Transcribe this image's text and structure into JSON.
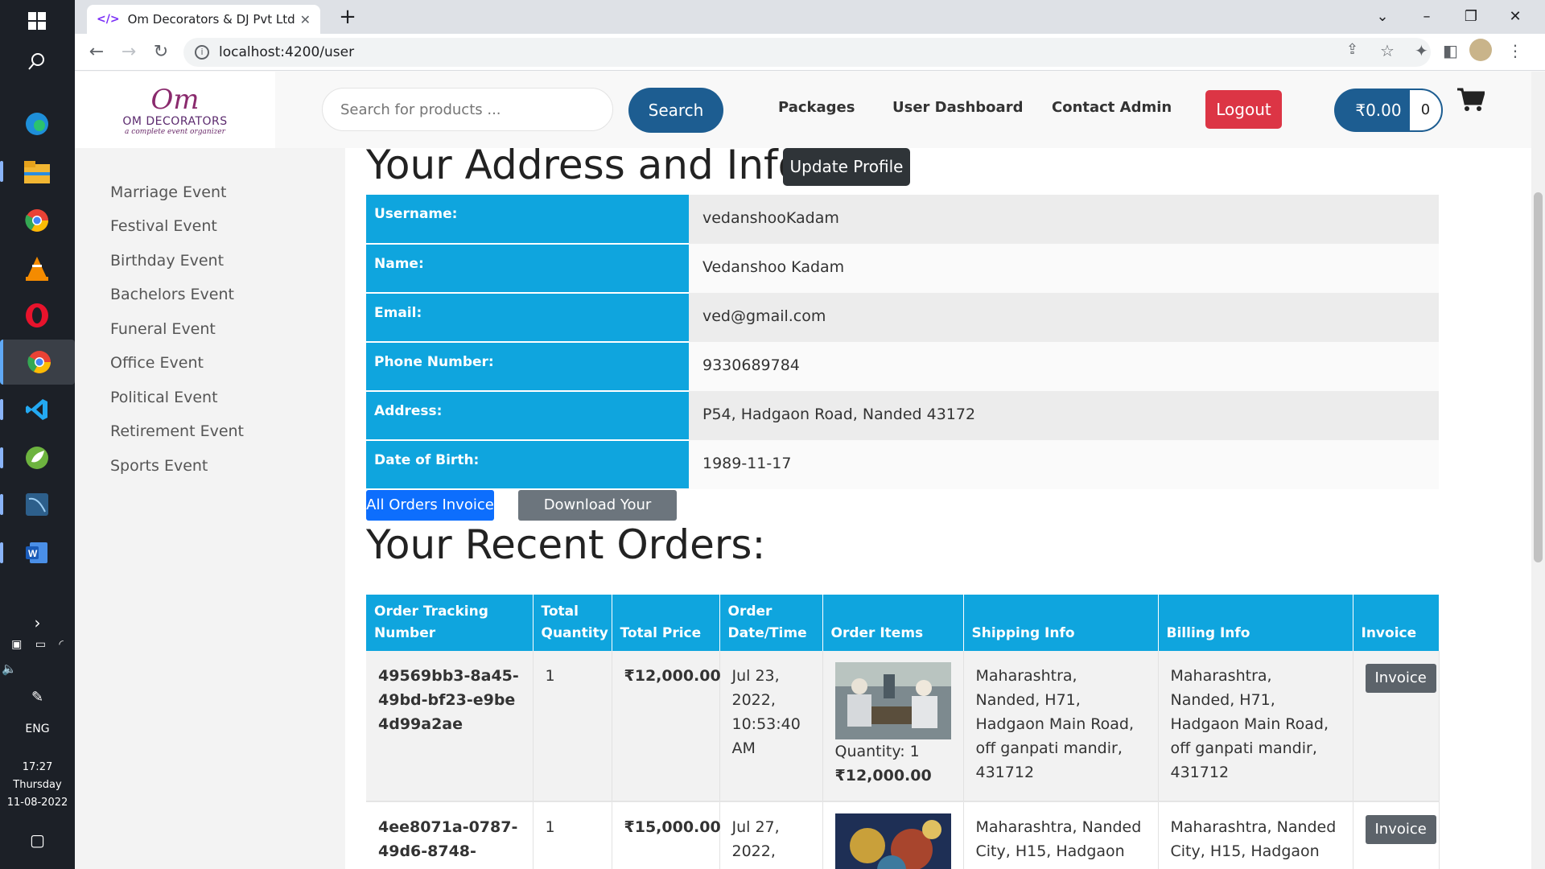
{
  "browser": {
    "tab_title": "Om Decorators & DJ Pvt Ltd",
    "url": "localhost:4200/user"
  },
  "taskbar": {
    "language": "ENG",
    "time": "17:27",
    "day": "Thursday",
    "date": "11-08-2022"
  },
  "header": {
    "logo_mark": "Om",
    "logo_text": "OM DECORATORS",
    "logo_tagline": "a complete event organizer",
    "search_placeholder": "Search for products ...",
    "search_label": "Search",
    "nav": [
      "Packages",
      "User Dashboard",
      "Contact Admin"
    ],
    "logout_label": "Logout",
    "cart_total": "₹0.00",
    "cart_count": "0"
  },
  "sidebar": {
    "items": [
      "Marriage Event",
      "Festival Event",
      "Birthday Event",
      "Bachelors Event",
      "Funeral Event",
      "Office Event",
      "Political Event",
      "Retirement Event",
      "Sports Event"
    ]
  },
  "profile": {
    "title": "Your Address and Info:",
    "update_label": "Update Profile",
    "rows": [
      {
        "label": "Username:",
        "value": "vedanshooKadam"
      },
      {
        "label": "Name:",
        "value": "Vedanshoo Kadam"
      },
      {
        "label": "Email:",
        "value": "ved@gmail.com"
      },
      {
        "label": "Phone Number:",
        "value": "9330689784"
      },
      {
        "label": "Address:",
        "value": "P54, Hadgaon Road, Nanded 43172"
      },
      {
        "label": "Date of Birth:",
        "value": "1989-11-17"
      }
    ]
  },
  "actions": {
    "all_invoice_label": "All Orders Invoice",
    "download_label": "Download Your Orders"
  },
  "orders": {
    "title": "Your Recent Orders:",
    "columns": [
      "Order Tracking Number",
      "Total Quantity",
      "Total Price",
      "Order Date/Time",
      "Order Items",
      "Shipping Info",
      "Billing Info",
      "Invoice"
    ],
    "rows": [
      {
        "tracking": "49569bb3-8a45-49bd-bf23-e9be4d99a2ae",
        "quantity": "1",
        "price": "₹12,000.00",
        "datetime": "Jul 23, 2022, 10:53:40 AM",
        "item_quantity": "Quantity: 1",
        "item_price": "₹12,000.00",
        "shipping": "Maharashtra, Nanded, H71, Hadgaon Main Road, off ganpati mandir, 431712",
        "billing": "Maharashtra, Nanded, H71, Hadgaon Main Road, off ganpati mandir, 431712",
        "invoice_label": "Invoice"
      },
      {
        "tracking": "4ee8071a-0787-49d6-8748-",
        "quantity": "1",
        "price": "₹15,000.00",
        "datetime": "Jul 27, 2022,",
        "shipping": "Maharashtra, Nanded City, H15, Hadgaon",
        "billing": "Maharashtra, Nanded City, H15, Hadgaon",
        "invoice_label": "Invoice"
      }
    ]
  }
}
